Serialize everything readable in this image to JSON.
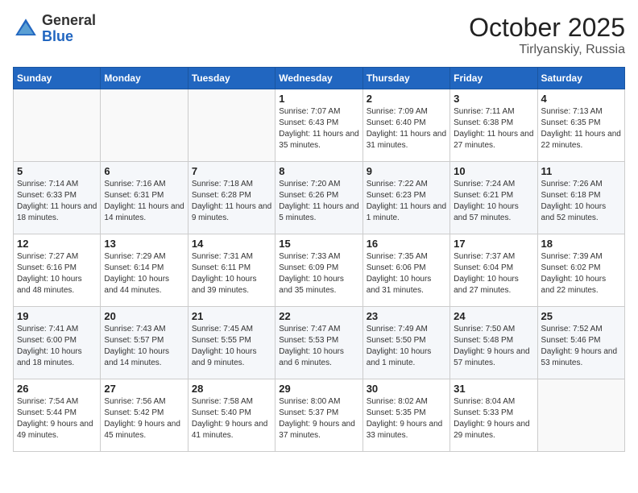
{
  "header": {
    "logo_general": "General",
    "logo_blue": "Blue",
    "month": "October 2025",
    "location": "Tirlyanskiy, Russia"
  },
  "weekdays": [
    "Sunday",
    "Monday",
    "Tuesday",
    "Wednesday",
    "Thursday",
    "Friday",
    "Saturday"
  ],
  "weeks": [
    [
      {
        "day": "",
        "info": ""
      },
      {
        "day": "",
        "info": ""
      },
      {
        "day": "",
        "info": ""
      },
      {
        "day": "1",
        "info": "Sunrise: 7:07 AM\nSunset: 6:43 PM\nDaylight: 11 hours and 35 minutes."
      },
      {
        "day": "2",
        "info": "Sunrise: 7:09 AM\nSunset: 6:40 PM\nDaylight: 11 hours and 31 minutes."
      },
      {
        "day": "3",
        "info": "Sunrise: 7:11 AM\nSunset: 6:38 PM\nDaylight: 11 hours and 27 minutes."
      },
      {
        "day": "4",
        "info": "Sunrise: 7:13 AM\nSunset: 6:35 PM\nDaylight: 11 hours and 22 minutes."
      }
    ],
    [
      {
        "day": "5",
        "info": "Sunrise: 7:14 AM\nSunset: 6:33 PM\nDaylight: 11 hours and 18 minutes."
      },
      {
        "day": "6",
        "info": "Sunrise: 7:16 AM\nSunset: 6:31 PM\nDaylight: 11 hours and 14 minutes."
      },
      {
        "day": "7",
        "info": "Sunrise: 7:18 AM\nSunset: 6:28 PM\nDaylight: 11 hours and 9 minutes."
      },
      {
        "day": "8",
        "info": "Sunrise: 7:20 AM\nSunset: 6:26 PM\nDaylight: 11 hours and 5 minutes."
      },
      {
        "day": "9",
        "info": "Sunrise: 7:22 AM\nSunset: 6:23 PM\nDaylight: 11 hours and 1 minute."
      },
      {
        "day": "10",
        "info": "Sunrise: 7:24 AM\nSunset: 6:21 PM\nDaylight: 10 hours and 57 minutes."
      },
      {
        "day": "11",
        "info": "Sunrise: 7:26 AM\nSunset: 6:18 PM\nDaylight: 10 hours and 52 minutes."
      }
    ],
    [
      {
        "day": "12",
        "info": "Sunrise: 7:27 AM\nSunset: 6:16 PM\nDaylight: 10 hours and 48 minutes."
      },
      {
        "day": "13",
        "info": "Sunrise: 7:29 AM\nSunset: 6:14 PM\nDaylight: 10 hours and 44 minutes."
      },
      {
        "day": "14",
        "info": "Sunrise: 7:31 AM\nSunset: 6:11 PM\nDaylight: 10 hours and 39 minutes."
      },
      {
        "day": "15",
        "info": "Sunrise: 7:33 AM\nSunset: 6:09 PM\nDaylight: 10 hours and 35 minutes."
      },
      {
        "day": "16",
        "info": "Sunrise: 7:35 AM\nSunset: 6:06 PM\nDaylight: 10 hours and 31 minutes."
      },
      {
        "day": "17",
        "info": "Sunrise: 7:37 AM\nSunset: 6:04 PM\nDaylight: 10 hours and 27 minutes."
      },
      {
        "day": "18",
        "info": "Sunrise: 7:39 AM\nSunset: 6:02 PM\nDaylight: 10 hours and 22 minutes."
      }
    ],
    [
      {
        "day": "19",
        "info": "Sunrise: 7:41 AM\nSunset: 6:00 PM\nDaylight: 10 hours and 18 minutes."
      },
      {
        "day": "20",
        "info": "Sunrise: 7:43 AM\nSunset: 5:57 PM\nDaylight: 10 hours and 14 minutes."
      },
      {
        "day": "21",
        "info": "Sunrise: 7:45 AM\nSunset: 5:55 PM\nDaylight: 10 hours and 9 minutes."
      },
      {
        "day": "22",
        "info": "Sunrise: 7:47 AM\nSunset: 5:53 PM\nDaylight: 10 hours and 6 minutes."
      },
      {
        "day": "23",
        "info": "Sunrise: 7:49 AM\nSunset: 5:50 PM\nDaylight: 10 hours and 1 minute."
      },
      {
        "day": "24",
        "info": "Sunrise: 7:50 AM\nSunset: 5:48 PM\nDaylight: 9 hours and 57 minutes."
      },
      {
        "day": "25",
        "info": "Sunrise: 7:52 AM\nSunset: 5:46 PM\nDaylight: 9 hours and 53 minutes."
      }
    ],
    [
      {
        "day": "26",
        "info": "Sunrise: 7:54 AM\nSunset: 5:44 PM\nDaylight: 9 hours and 49 minutes."
      },
      {
        "day": "27",
        "info": "Sunrise: 7:56 AM\nSunset: 5:42 PM\nDaylight: 9 hours and 45 minutes."
      },
      {
        "day": "28",
        "info": "Sunrise: 7:58 AM\nSunset: 5:40 PM\nDaylight: 9 hours and 41 minutes."
      },
      {
        "day": "29",
        "info": "Sunrise: 8:00 AM\nSunset: 5:37 PM\nDaylight: 9 hours and 37 minutes."
      },
      {
        "day": "30",
        "info": "Sunrise: 8:02 AM\nSunset: 5:35 PM\nDaylight: 9 hours and 33 minutes."
      },
      {
        "day": "31",
        "info": "Sunrise: 8:04 AM\nSunset: 5:33 PM\nDaylight: 9 hours and 29 minutes."
      },
      {
        "day": "",
        "info": ""
      }
    ]
  ]
}
